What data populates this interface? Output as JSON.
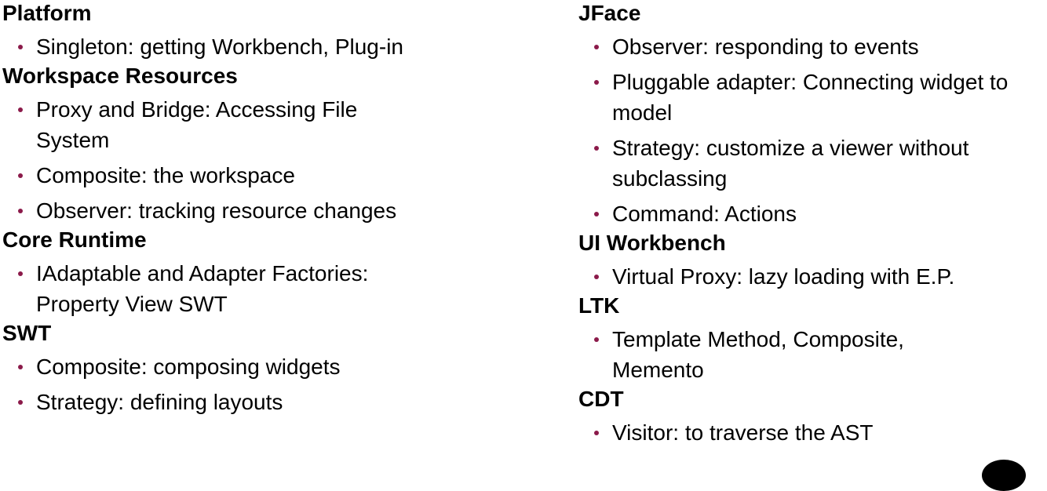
{
  "colors": {
    "bullet": "#8B1A4A",
    "text": "#000000"
  },
  "left_column": [
    {
      "title": "Platform",
      "items": [
        "Singleton: getting Workbench, Plug-in"
      ]
    },
    {
      "title": "Workspace Resources",
      "items": [
        "Proxy and Bridge: Accessing File System",
        "Composite: the workspace",
        "Observer: tracking resource changes"
      ]
    },
    {
      "title": "Core Runtime",
      "items": [
        "IAdaptable and Adapter Factories: Property View SWT"
      ]
    },
    {
      "title": "SWT",
      "items": [
        "Composite: composing widgets",
        "Strategy: defining layouts"
      ]
    }
  ],
  "right_column": [
    {
      "title": "JFace",
      "items": [
        "Observer: responding to events",
        "Pluggable adapter: Connecting widget to model",
        "Strategy: customize a viewer without subclassing",
        "Command: Actions"
      ]
    },
    {
      "title": "UI Workbench",
      "items": [
        "Virtual Proxy: lazy loading with E.P."
      ]
    },
    {
      "title": "LTK",
      "items": [
        "Template Method, Composite, Memento"
      ]
    },
    {
      "title": "CDT",
      "items": [
        "Visitor: to traverse the AST"
      ]
    }
  ]
}
